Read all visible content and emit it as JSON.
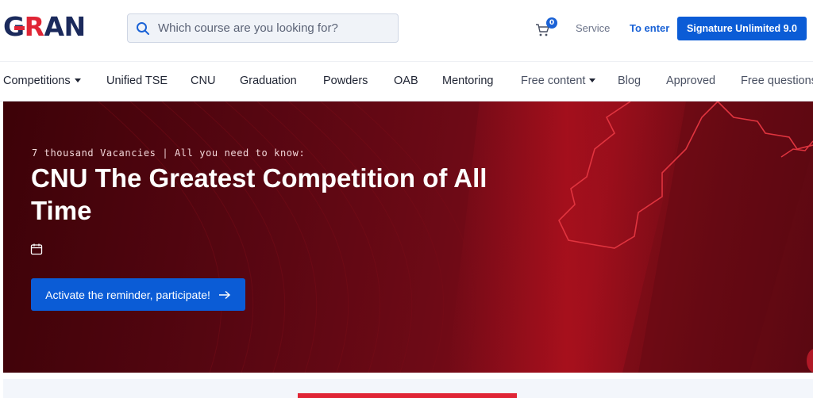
{
  "header": {
    "logo": {
      "part1": "G",
      "part2": "R",
      "part3": "AN"
    },
    "search": {
      "placeholder": "Which course are you looking for?",
      "value": "",
      "icon": "search-icon"
    },
    "cart": {
      "icon": "cart-icon",
      "count": "0"
    },
    "service_label": "Service",
    "enter_label": "To enter",
    "signature_label": "Signature  Unlimited 9.0"
  },
  "nav": {
    "items": [
      {
        "label": "Competitions",
        "dropdown": true
      },
      {
        "label": "Unified TSE"
      },
      {
        "label": "CNU"
      },
      {
        "label": "Graduation"
      },
      {
        "label": "Powders"
      },
      {
        "label": "OAB"
      },
      {
        "label": "Mentoring"
      },
      {
        "label": "Free content",
        "dropdown": true
      },
      {
        "label": "Blog"
      },
      {
        "label": "Approved"
      },
      {
        "label": "Free questions"
      }
    ]
  },
  "hero": {
    "kicker": "7 thousand Vacancies | All you need to know:",
    "title": "CNU The Greatest Competition of All Time",
    "calendar_icon": "calendar-icon",
    "cta_label": "Activate the reminder, participate!",
    "cta_icon": "arrow-right-icon"
  },
  "colors": {
    "brand_navy": "#1b2a5c",
    "brand_red": "#e02535",
    "primary_blue": "#0b5cd6",
    "hero_dark": "#3d0208",
    "hero_mid": "#8a0d19"
  }
}
